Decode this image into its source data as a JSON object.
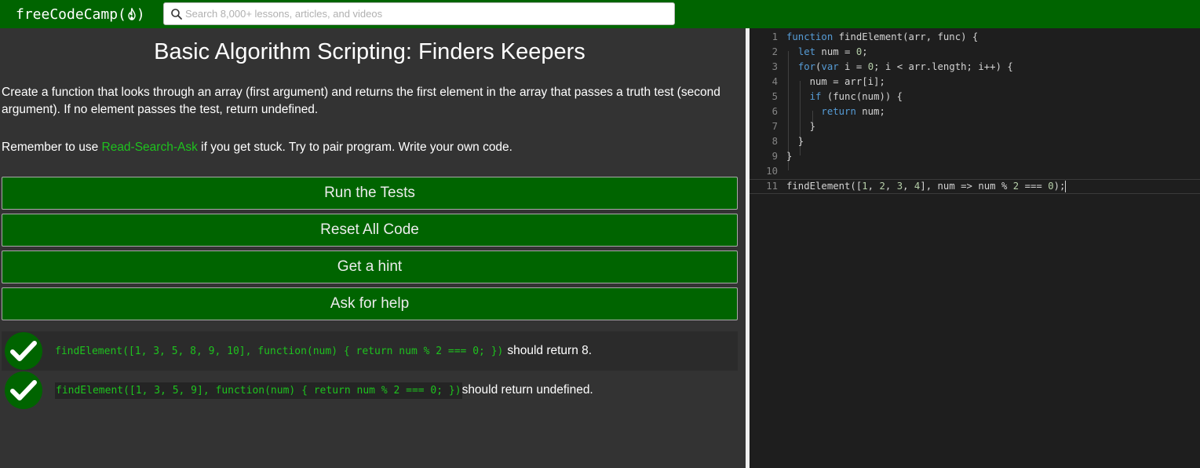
{
  "navbar": {
    "logo_text": "freeCodeCamp",
    "logo_open": "(",
    "logo_close": ")",
    "search_placeholder": "Search 8,000+ lessons, articles, and videos"
  },
  "challenge": {
    "title": "Basic Algorithm Scripting: Finders Keepers",
    "description": "Create a function that looks through an array (first argument) and returns the first element in the array that passes a truth test (second argument). If no element passes the test, return undefined.",
    "remember_prefix": "Remember to use ",
    "remember_link": "Read-Search-Ask",
    "remember_suffix": " if you get stuck. Try to pair program. Write your own code."
  },
  "buttons": {
    "run": "Run the Tests",
    "reset": "Reset All Code",
    "hint": "Get a hint",
    "help": "Ask for help"
  },
  "tests": [
    {
      "code": "findElement([1, 3, 5, 8, 9, 10], function(num) { return num % 2 === 0; })",
      "message": "should return 8.",
      "passed": true
    },
    {
      "code": "findElement([1, 3, 5, 9], function(num) { return num % 2 === 0; })",
      "message": "should return undefined.",
      "passed": true
    }
  ],
  "editor": {
    "line_numbers": [
      "1",
      "2",
      "3",
      "4",
      "5",
      "6",
      "7",
      "8",
      "9",
      "10",
      "11"
    ],
    "lines": [
      "function findElement(arr, func) {",
      "  let num = 0;",
      "  for(var i = 0; i < arr.length; i++) {",
      "    num = arr[i];",
      "    if (func(num)) {",
      "      return num;",
      "    }",
      "  }",
      "}",
      "",
      "findElement([1, 2, 3, 4], num => num % 2 === 0);"
    ]
  },
  "colors": {
    "brand_green": "#006400",
    "link_green": "#1ec31e",
    "panel_bg": "#333333",
    "editor_bg": "#1e1e1e",
    "keyword_blue": "#569cd6",
    "number_green": "#b5cea8"
  }
}
